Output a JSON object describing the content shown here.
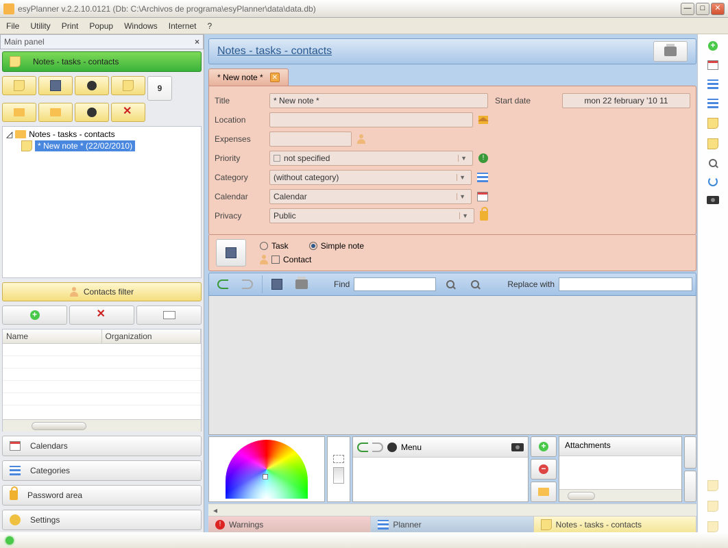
{
  "titlebar": "esyPlanner v.2.2.10.0121 (Db: C:\\Archivos de programa\\esyPlanner\\data\\data.db)",
  "menu": {
    "file": "File",
    "utility": "Utility",
    "print": "Print",
    "popup": "Popup",
    "windows": "Windows",
    "internet": "Internet",
    "help": "?"
  },
  "left": {
    "panel_title": "Main panel",
    "greenbar": "Notes - tasks - contacts",
    "calbtn": "9",
    "tree_root": "Notes - tasks - contacts",
    "tree_item": "* New note * (22/02/2010)",
    "contacts_filter": "Contacts filter",
    "name_col": "Name",
    "org_col": "Organization",
    "cal_btn": "Calendars",
    "cat_btn": "Categories",
    "pwd_btn": "Password area",
    "set_btn": "Settings"
  },
  "page": {
    "title": "Notes - tasks - contacts",
    "tab": "* New note *",
    "form": {
      "title_lbl": "Title",
      "title_val": "* New note *",
      "loc_lbl": "Location",
      "loc_val": "",
      "exp_lbl": "Expenses",
      "exp_val": "",
      "prio_lbl": "Priority",
      "prio_val": "not specified",
      "cat_lbl": "Category",
      "cat_val": "(without category)",
      "cal_lbl": "Calendar",
      "cal_val": "Calendar",
      "priv_lbl": "Privacy",
      "priv_val": "Public",
      "start_lbl": "Start date",
      "start_val": "mon 22 february '10  11"
    },
    "type": {
      "task": "Task",
      "simple": "Simple note",
      "contact": "Contact"
    },
    "find_lbl": "Find",
    "replace_lbl": "Replace with",
    "drawmenu": "Menu",
    "attachments": "Attachments"
  },
  "tabs": {
    "warn": "Warnings",
    "plan": "Planner",
    "notes": "Notes - tasks - contacts"
  }
}
